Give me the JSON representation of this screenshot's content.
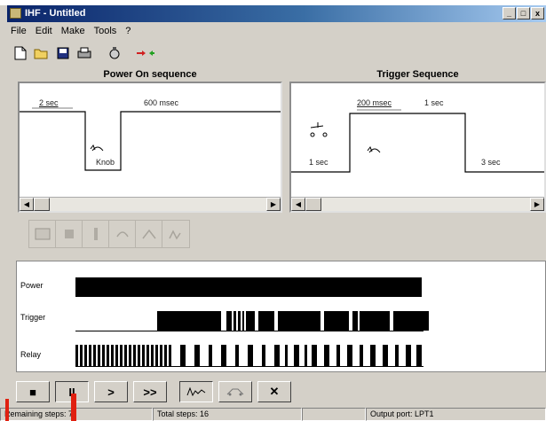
{
  "window": {
    "title": "IHF - Untitled",
    "buttons": [
      "_",
      "□",
      "x"
    ]
  },
  "menu": [
    "File",
    "Edit",
    "Make",
    "Tools",
    "?"
  ],
  "toolbar": [
    "new-icon",
    "open-icon",
    "save-icon",
    "print-icon",
    "settings-icon",
    "connect-icon"
  ],
  "power_on": {
    "title": "Power On sequence",
    "label_high": "2 sec",
    "label_time": "600 msec",
    "label_knob": "Knob"
  },
  "trigger": {
    "title": "Trigger Sequence",
    "label_pulse": "200 msec",
    "label_high": "1 sec",
    "label_pre": "1 sec",
    "label_post": "3 sec"
  },
  "timing": {
    "rows": [
      "Power",
      "Trigger",
      "Relay"
    ]
  },
  "transport": {
    "buttons": [
      "■",
      "II",
      ">",
      ">>",
      "",
      "",
      "✕"
    ]
  },
  "status": {
    "remaining": "Remaining steps: 7",
    "total": "Total steps: 16",
    "output": "Output port: LPT1"
  }
}
